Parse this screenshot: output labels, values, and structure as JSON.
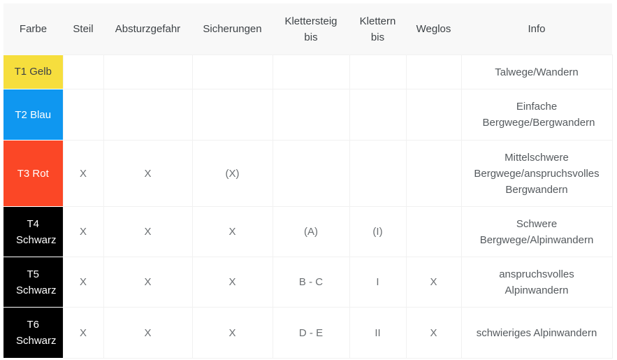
{
  "table": {
    "headers": [
      "Farbe",
      "Steil",
      "Absturzgefahr",
      "Sicherungen",
      "Klettersteig bis",
      "Klettern bis",
      "Weglos",
      "Info"
    ],
    "rows": [
      {
        "farbe": "T1 Gelb",
        "color": "#f6de3d",
        "text_color": "#3d4246",
        "steil": "",
        "absturzgefahr": "",
        "sicherungen": "",
        "klettersteig": "",
        "klettern": "",
        "weglos": "",
        "info": "Talwege/Wandern"
      },
      {
        "farbe": "T2 Blau",
        "color": "#0f97f0",
        "text_color": "#ffffff",
        "steil": "",
        "absturzgefahr": "",
        "sicherungen": "",
        "klettersteig": "",
        "klettern": "",
        "weglos": "",
        "info": "Einfache Bergwege/Bergwandern"
      },
      {
        "farbe": "T3 Rot",
        "color": "#fb4726",
        "text_color": "#ffffff",
        "steil": "X",
        "absturzgefahr": "X",
        "sicherungen": "(X)",
        "klettersteig": "",
        "klettern": "",
        "weglos": "",
        "info": "Mittelschwere Bergwege/anspruchsvolles Bergwandern"
      },
      {
        "farbe": "T4 Schwarz",
        "color": "#000000",
        "text_color": "#ffffff",
        "steil": "X",
        "absturzgefahr": "X",
        "sicherungen": "X",
        "klettersteig": "(A)",
        "klettern": "(I)",
        "weglos": "",
        "info": "Schwere Bergwege/Alpinwandern"
      },
      {
        "farbe": "T5 Schwarz",
        "color": "#000000",
        "text_color": "#ffffff",
        "steil": "X",
        "absturzgefahr": "X",
        "sicherungen": "X",
        "klettersteig": "B - C",
        "klettern": "I",
        "weglos": "X",
        "info": "anspruchsvolles Alpinwandern"
      },
      {
        "farbe": "T6 Schwarz",
        "color": "#000000",
        "text_color": "#ffffff",
        "steil": "X",
        "absturzgefahr": "X",
        "sicherungen": "X",
        "klettersteig": "D - E",
        "klettern": "II",
        "weglos": "X",
        "info": "schwieriges Alpinwandern"
      }
    ]
  }
}
